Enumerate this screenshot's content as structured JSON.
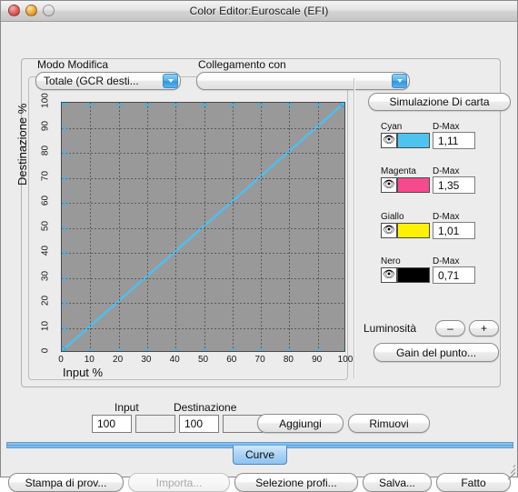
{
  "window": {
    "title": "Color Editor:Euroscale (EFI)",
    "traffic_lights": [
      "close-button",
      "minimize-button",
      "zoom-button"
    ]
  },
  "controls": {
    "modo_modifica_label": "Modo Modifica",
    "modo_modifica_value": "Totale (GCR desti...",
    "collegamento_label": "Collegamento con",
    "collegamento_value": ""
  },
  "chart_data": {
    "type": "line",
    "title": "",
    "xlabel": "Input %",
    "ylabel": "Destinazione %",
    "xlim": [
      0,
      100
    ],
    "ylim": [
      0,
      100
    ],
    "xticks": [
      0,
      10,
      20,
      30,
      40,
      50,
      60,
      70,
      80,
      90,
      100
    ],
    "yticks": [
      0,
      10,
      20,
      30,
      40,
      50,
      60,
      70,
      80,
      90,
      100
    ],
    "grid": true,
    "legend": "none",
    "series": [
      {
        "name": "Curve",
        "color": "#4FBEEF",
        "x": [
          0,
          100
        ],
        "y": [
          0,
          100
        ],
        "points": [
          {
            "input": 0,
            "destinazione": 0
          },
          {
            "input": 100,
            "destinazione": 100
          }
        ]
      }
    ],
    "plot_background": "#999999"
  },
  "right_panel": {
    "simulazione_button": "Simulazione Di carta",
    "inks": [
      {
        "name": "Cyan",
        "dmax_label": "D-Max",
        "dmax_value": "1,11",
        "color": "#4FC3F0",
        "visible": true
      },
      {
        "name": "Magenta",
        "dmax_label": "D-Max",
        "dmax_value": "1,35",
        "color": "#F54A8C",
        "visible": true
      },
      {
        "name": "Giallo",
        "dmax_label": "D-Max",
        "dmax_value": "1,01",
        "color": "#FFF200",
        "visible": true
      },
      {
        "name": "Nero",
        "dmax_label": "D-Max",
        "dmax_value": "0,71",
        "color": "#000000",
        "visible": true
      }
    ],
    "luminosita_label": "Luminosità",
    "luminosita_minus": "–",
    "luminosita_plus": "+",
    "gain_button": "Gain del punto..."
  },
  "point_editor": {
    "input_label": "Input",
    "destinazione_label": "Destinazione",
    "input_value": "100",
    "input_value_2": "",
    "destinazione_value": "100",
    "destinazione_value_2": "",
    "add_button": "Aggiungi",
    "remove_button": "Rimuovi"
  },
  "tabs": {
    "active": "Curve"
  },
  "footer": {
    "stampa": "Stampa di prov...",
    "importa": "Importa...",
    "selezione": "Selezione profi...",
    "salva": "Salva...",
    "fatto": "Fatto"
  },
  "colors": {
    "plot_bg": "#999999",
    "curve": "#4FBEEF",
    "window_bg": "#ECECEC",
    "accent": "#4FA3E3"
  }
}
